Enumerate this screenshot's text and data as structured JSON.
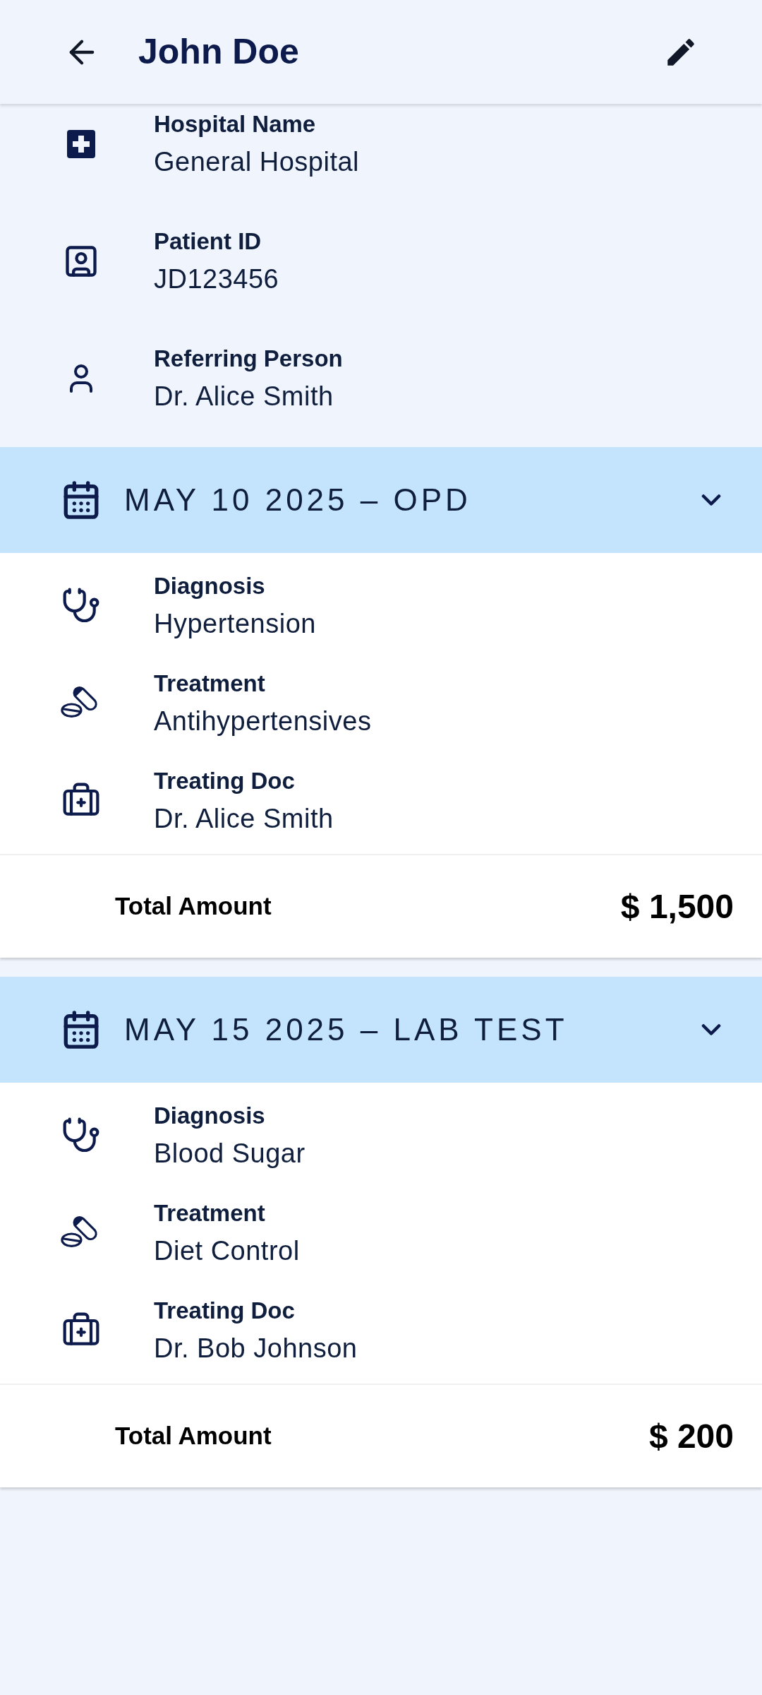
{
  "app_bar": {
    "title": "John Doe"
  },
  "patient_info": [
    {
      "kind": "hospital",
      "label": "Hospital Name",
      "value": "General Hospital"
    },
    {
      "kind": "patient_id",
      "label": "Patient ID",
      "value": "JD123456"
    },
    {
      "kind": "person",
      "label": "Referring Person",
      "value": "Dr. Alice Smith"
    }
  ],
  "visits": [
    {
      "title": "MAY 10 2025 – OPD",
      "expanded": true,
      "details": [
        {
          "kind": "diagnosis",
          "label": "Diagnosis",
          "value": "Hypertension"
        },
        {
          "kind": "treatment",
          "label": "Treatment",
          "value": "Antihypertensives"
        },
        {
          "kind": "doctor",
          "label": "Treating Doc",
          "value": "Dr. Alice Smith"
        }
      ],
      "total_label": "Total Amount",
      "total_amount": "$ 1,500"
    },
    {
      "title": "MAY 15 2025 – LAB TEST",
      "expanded": true,
      "details": [
        {
          "kind": "diagnosis",
          "label": "Diagnosis",
          "value": "Blood Sugar"
        },
        {
          "kind": "treatment",
          "label": "Treatment",
          "value": "Diet Control"
        },
        {
          "kind": "doctor",
          "label": "Treating Doc",
          "value": "Dr. Bob Johnson"
        }
      ],
      "total_label": "Total Amount",
      "total_amount": "$ 200"
    }
  ]
}
